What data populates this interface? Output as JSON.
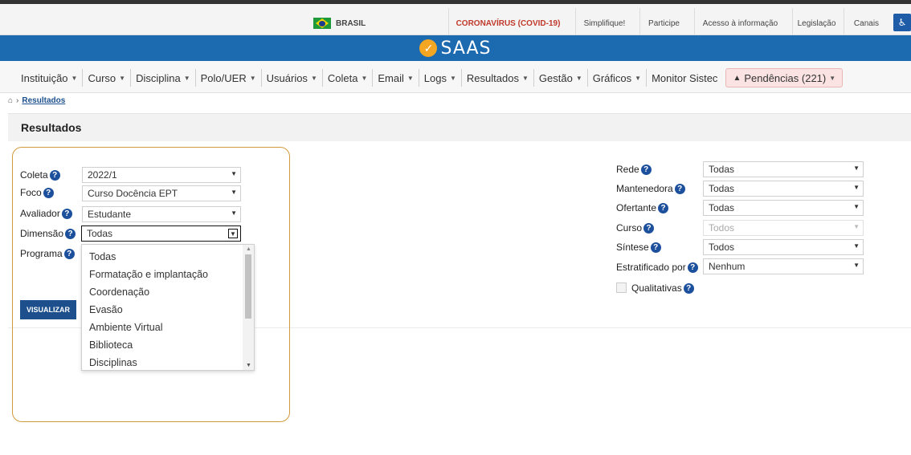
{
  "govbar": {
    "country": "BRASIL",
    "covid": "CORONAVÍRUS (COVID-19)",
    "links": [
      "Simplifique!",
      "Participe",
      "Acesso à informação",
      "Legislação",
      "Canais"
    ]
  },
  "brand": {
    "name": "SAAS"
  },
  "menu": {
    "items": [
      {
        "label": "Instituição"
      },
      {
        "label": "Curso"
      },
      {
        "label": "Disciplina"
      },
      {
        "label": "Polo/UER"
      },
      {
        "label": "Usuários"
      },
      {
        "label": "Coleta"
      },
      {
        "label": "Email"
      },
      {
        "label": "Logs"
      },
      {
        "label": "Resultados"
      },
      {
        "label": "Gestão"
      },
      {
        "label": "Gráficos"
      }
    ],
    "monitor": "Monitor Sistec",
    "pendencias": "Pendências (221)"
  },
  "breadcrumb": {
    "current": "Resultados"
  },
  "panel": {
    "title": "Resultados"
  },
  "left_form": {
    "coleta_label": "Coleta",
    "coleta_value": "2022/1",
    "foco_label": "Foco",
    "foco_value": "Curso Docência EPT",
    "avaliador_label": "Avaliador",
    "avaliador_value": "Estudante",
    "dimensao_label": "Dimensão",
    "dimensao_value": "Todas",
    "programa_label": "Programa",
    "button": "VISUALIZAR"
  },
  "dimensao_options": [
    "Todas",
    "Formatação e implantação",
    "Coordenação",
    "Evasão",
    "Ambiente Virtual",
    "Biblioteca",
    "Disciplinas"
  ],
  "right_form": {
    "rede_label": "Rede",
    "rede_value": "Todas",
    "mantenedora_label": "Mantenedora",
    "mantenedora_value": "Todas",
    "ofertante_label": "Ofertante",
    "ofertante_value": "Todas",
    "curso_label": "Curso",
    "curso_value": "Todos",
    "sintese_label": "Síntese",
    "sintese_value": "Todos",
    "estratificado_label": "Estratificado por",
    "estratificado_value": "Nenhum",
    "qualitativas_label": "Qualitativas"
  },
  "colors": {
    "brand_blue": "#1c6ab0",
    "button_blue": "#1c4f8c",
    "highlight": "#d19a3a",
    "covid_red": "#c0392b"
  }
}
